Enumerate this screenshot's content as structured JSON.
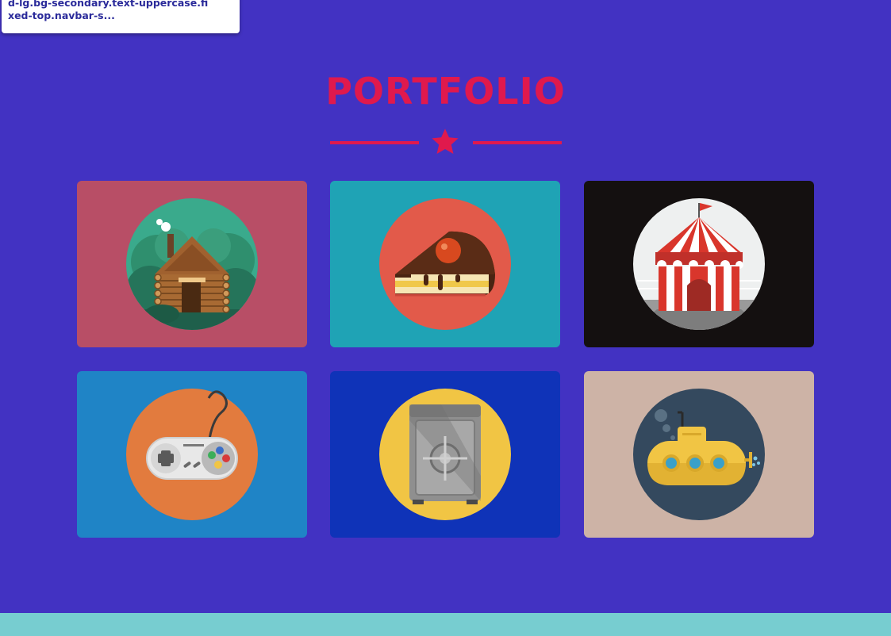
{
  "tooltip": {
    "line1": "d-lg.bg-secondary.text-uppercase.fi",
    "line2": "xed-top.navbar-s..."
  },
  "portfolio": {
    "title": "PORTFOLIO",
    "accent_color": "#e0194d",
    "items": [
      {
        "icon": "cabin-icon",
        "bg": "#b84e66",
        "circle": "#3aaa8c"
      },
      {
        "icon": "cake-icon",
        "bg": "#1fa3b5",
        "circle": "#e25a4a"
      },
      {
        "icon": "circus-tent-icon",
        "bg": "#141010",
        "circle": "#eef0f0"
      },
      {
        "icon": "game-controller-icon",
        "bg": "#1f84c6",
        "circle": "#e27b3e"
      },
      {
        "icon": "safe-icon",
        "bg": "#0f33b8",
        "circle": "#f1c544"
      },
      {
        "icon": "submarine-icon",
        "bg": "#cdb3a6",
        "circle": "#34495e"
      }
    ]
  },
  "colors": {
    "page_bg": "#4232c2",
    "footer_bg": "#77cdd0"
  }
}
